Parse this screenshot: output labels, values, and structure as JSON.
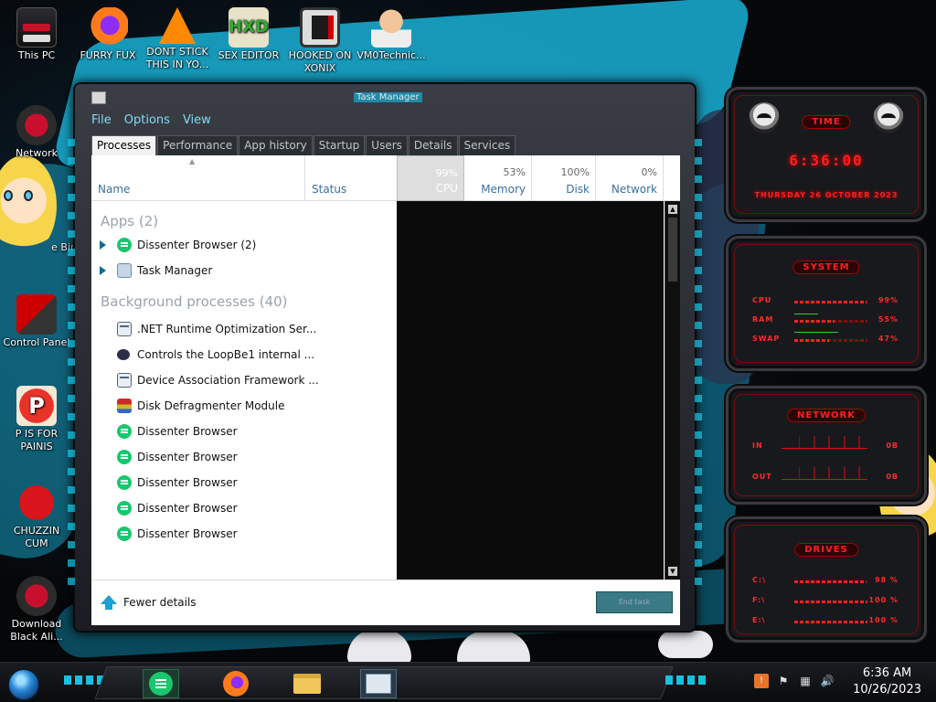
{
  "desktop": {
    "icons": [
      {
        "label": "This PC",
        "icon": "this-pc-icon"
      },
      {
        "label": "FURRY FUX",
        "icon": "firefox-icon"
      },
      {
        "label": "DONT STICK THIS IN YO...",
        "icon": "vlc-icon"
      },
      {
        "label": "SEX EDITOR",
        "icon": "hxd-icon"
      },
      {
        "label": "HOOKED ON XONIX",
        "icon": "xonix-icon"
      },
      {
        "label": "VM0Technic...",
        "icon": "doctor-icon"
      },
      {
        "label": "Network",
        "icon": "alien-network-icon"
      },
      {
        "label": "e Bin",
        "icon": "recycle-bin-icon"
      },
      {
        "label": "Control Panel",
        "icon": "control-panel-icon"
      },
      {
        "label": "P IS FOR PAINIS",
        "icon": "p-icon"
      },
      {
        "label": "CHUZZIN CUM",
        "icon": "chuzzle-icon"
      },
      {
        "label": "Download Black Ali...",
        "icon": "alien-download-icon"
      }
    ]
  },
  "task_manager": {
    "title": "Task Manager",
    "menu": [
      "File",
      "Options",
      "View"
    ],
    "tabs": [
      "Processes",
      "Performance",
      "App history",
      "Startup",
      "Users",
      "Details",
      "Services"
    ],
    "active_tab": "Processes",
    "columns": {
      "name": "Name",
      "status": "Status",
      "cpu": {
        "label": "CPU",
        "pct": "99%"
      },
      "memory": {
        "label": "Memory",
        "pct": "53%"
      },
      "disk": {
        "label": "Disk",
        "pct": "100%"
      },
      "network": {
        "label": "Network",
        "pct": "0%"
      }
    },
    "groups": {
      "apps": "Apps (2)",
      "background": "Background processes (40)"
    },
    "apps": [
      {
        "name": "Dissenter Browser (2)",
        "icon": "dissenter-icon"
      },
      {
        "name": "Task Manager",
        "icon": "task-manager-icon"
      }
    ],
    "background": [
      {
        "name": ".NET Runtime Optimization Ser...",
        "icon": "window-icon"
      },
      {
        "name": "Controls the LoopBe1 internal ...",
        "icon": "loopbe-icon"
      },
      {
        "name": "Device Association Framework ...",
        "icon": "window-icon"
      },
      {
        "name": "Disk Defragmenter Module",
        "icon": "defrag-icon"
      },
      {
        "name": "Dissenter Browser",
        "icon": "dissenter-icon"
      },
      {
        "name": "Dissenter Browser",
        "icon": "dissenter-icon"
      },
      {
        "name": "Dissenter Browser",
        "icon": "dissenter-icon"
      },
      {
        "name": "Dissenter Browser",
        "icon": "dissenter-icon"
      },
      {
        "name": "Dissenter Browser",
        "icon": "dissenter-icon"
      }
    ],
    "footer": {
      "fewer_details": "Fewer details",
      "end_task": "End task"
    }
  },
  "widgets": {
    "time": {
      "title": "TIME",
      "clock": "6:36:00",
      "date": "THURSDAY 26 OCTOBER 2023"
    },
    "system": {
      "title": "SYSTEM",
      "rows": [
        {
          "label": "CPU",
          "value": "99%",
          "level": 0.99
        },
        {
          "label": "RAM",
          "value": "55%",
          "level": 0.55
        },
        {
          "label": "SWAP",
          "value": "47%",
          "level": 0.47
        }
      ]
    },
    "network": {
      "title": "NETWORK",
      "rows": [
        {
          "label": "IN",
          "value": "0B"
        },
        {
          "label": "OUT",
          "value": "0B"
        }
      ]
    },
    "drives": {
      "title": "DRIVES",
      "rows": [
        {
          "label": "C:\\",
          "value": "98 %",
          "level": 0.98
        },
        {
          "label": "F:\\",
          "value": "100 %",
          "level": 1.0
        },
        {
          "label": "E:\\",
          "value": "100 %",
          "level": 1.0
        }
      ]
    }
  },
  "taskbar": {
    "apps": [
      "Dissenter Browser",
      "Firefox",
      "File Explorer",
      "Task Manager"
    ],
    "tray_icons": [
      "warning-flag-icon",
      "flag-icon",
      "network-icon",
      "volume-icon"
    ],
    "time": "6:36 AM",
    "date": "10/26/2023"
  }
}
